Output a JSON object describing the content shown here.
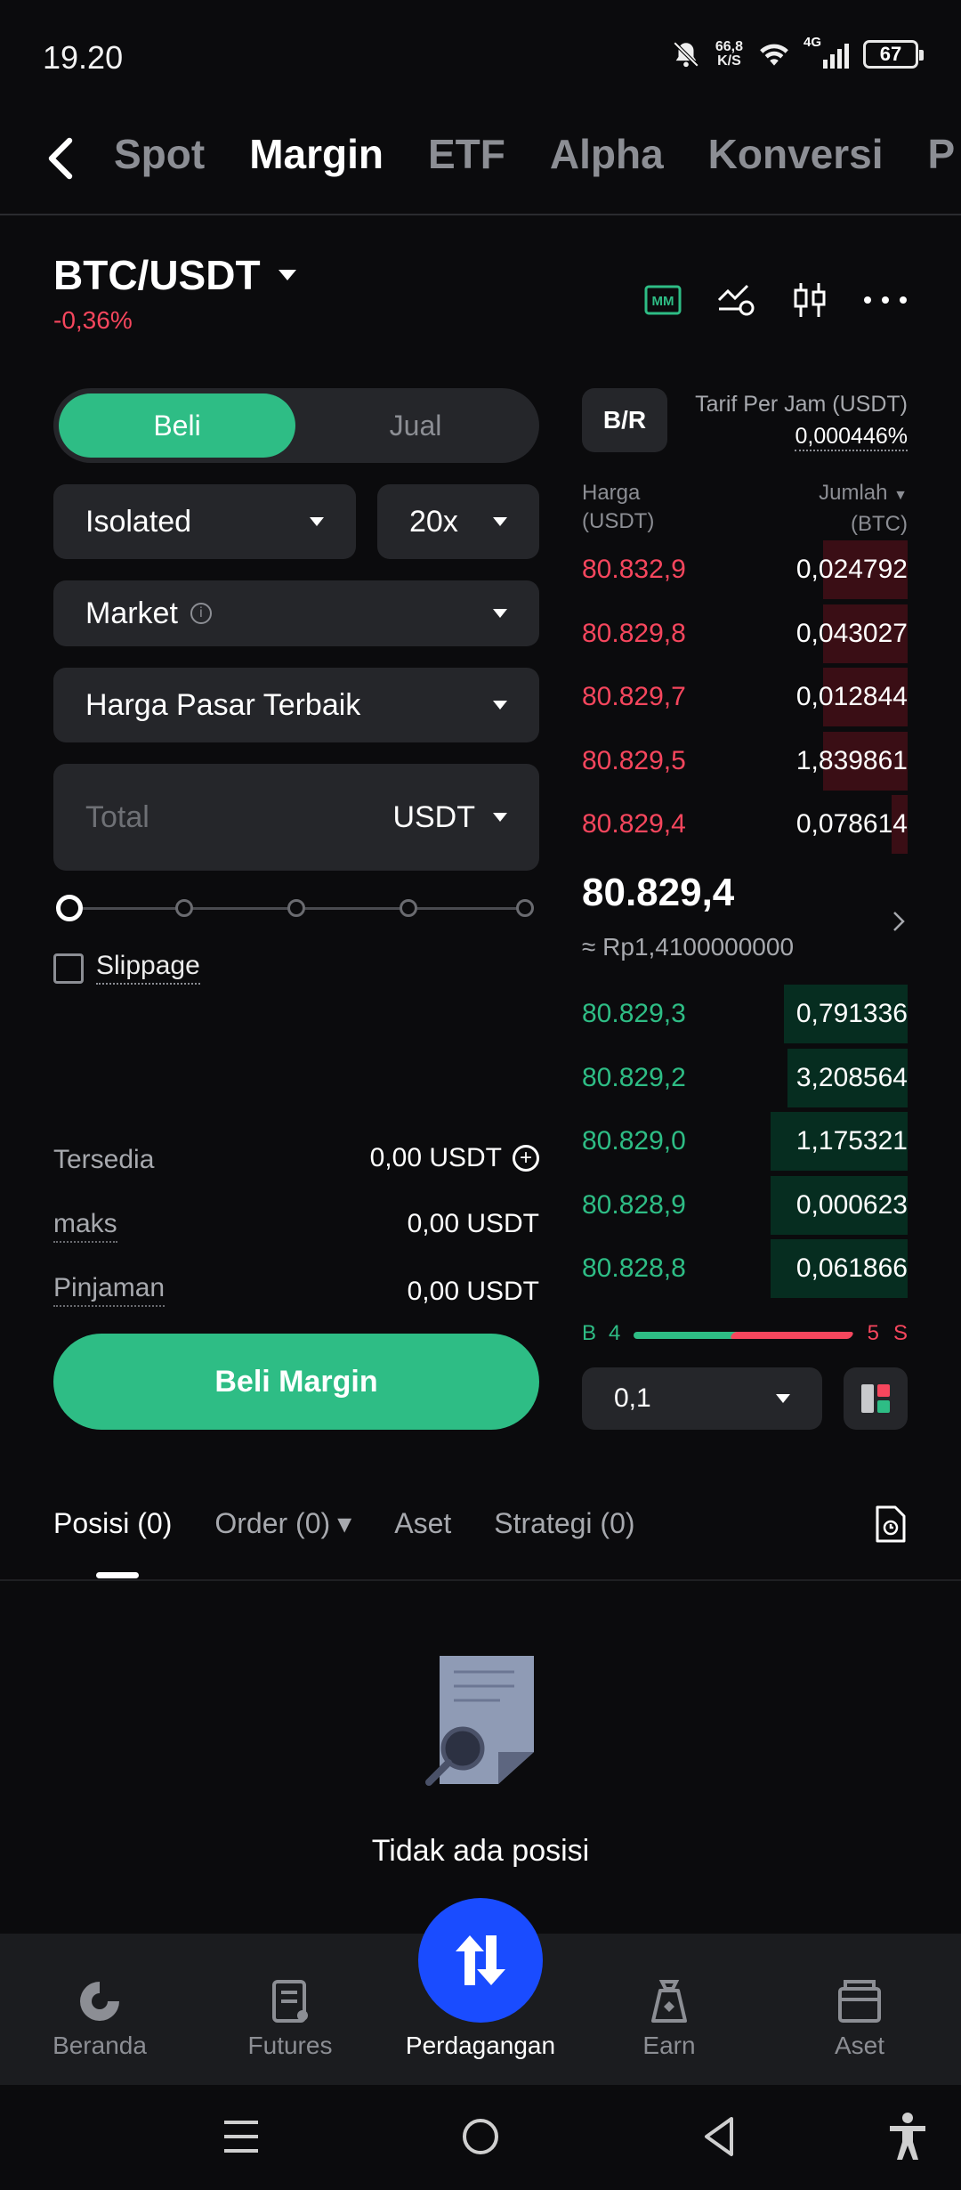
{
  "status": {
    "time": "19.20",
    "speed_value": "66,8",
    "speed_unit": "K/S",
    "network": "4G",
    "battery": "67"
  },
  "nav": {
    "tabs": [
      "Spot",
      "Margin",
      "ETF",
      "Alpha",
      "Konversi",
      "P"
    ],
    "active_tab": "Margin"
  },
  "pair": {
    "symbol": "BTC/USDT",
    "change": "-0,36%"
  },
  "header_icons": [
    "mm-icon",
    "compare-icon",
    "candlestick-icon",
    "more-icon"
  ],
  "form": {
    "buy_label": "Beli",
    "sell_label": "Jual",
    "margin_mode": "Isolated",
    "leverage": "20x",
    "order_type": "Market",
    "price_type": "Harga Pasar Terbaik",
    "total_placeholder": "Total",
    "total_unit": "USDT",
    "slippage_label": "Slippage",
    "available_label": "Tersedia",
    "available_value": "0,00 USDT",
    "max_label": "maks",
    "max_value": "0,00 USDT",
    "loan_label": "Pinjaman",
    "loan_value": "0,00 USDT",
    "submit_label": "Beli Margin",
    "slider_percent": 0
  },
  "orderbook": {
    "br_label": "B/R",
    "rate_label": "Tarif Per Jam (USDT)",
    "rate_value": "0,000446%",
    "price_header": "Harga",
    "price_unit": "(USDT)",
    "qty_header": "Jumlah",
    "qty_unit": "(BTC)",
    "asks": [
      {
        "price": "80.832,9",
        "qty": "0,024792",
        "depth": 0.26
      },
      {
        "price": "80.829,8",
        "qty": "0,043027",
        "depth": 0.26
      },
      {
        "price": "80.829,7",
        "qty": "0,012844",
        "depth": 0.26
      },
      {
        "price": "80.829,5",
        "qty": "1,839861",
        "depth": 0.26
      },
      {
        "price": "80.829,4",
        "qty": "0,078614",
        "depth": 0.05
      }
    ],
    "last_price": "80.829,4",
    "last_price_idr": "≈ Rp1,4100000000",
    "bids": [
      {
        "price": "80.829,3",
        "qty": "0,791336",
        "depth": 0.38
      },
      {
        "price": "80.829,2",
        "qty": "3,208564",
        "depth": 0.37
      },
      {
        "price": "80.829,0",
        "qty": "1,175321",
        "depth": 0.42
      },
      {
        "price": "80.828,9",
        "qty": "0,000623",
        "depth": 0.42
      },
      {
        "price": "80.828,8",
        "qty": "0,061866",
        "depth": 0.42
      }
    ],
    "ratio_b_label": "B",
    "ratio_b_value": "4",
    "ratio_s_value": "5",
    "ratio_s_label": "S",
    "step": "0,1"
  },
  "positions": {
    "tabs": [
      "Posisi (0)",
      "Order (0)",
      "Aset",
      "Strategi (0)"
    ],
    "empty_text": "Tidak ada posisi"
  },
  "bottom_nav": {
    "items": [
      "Beranda",
      "Futures",
      "Perdagangan",
      "Earn",
      "Aset"
    ],
    "active": "Perdagangan"
  },
  "colors": {
    "green": "#2ebd85",
    "red": "#f6465d",
    "accent": "#1a4cff"
  }
}
